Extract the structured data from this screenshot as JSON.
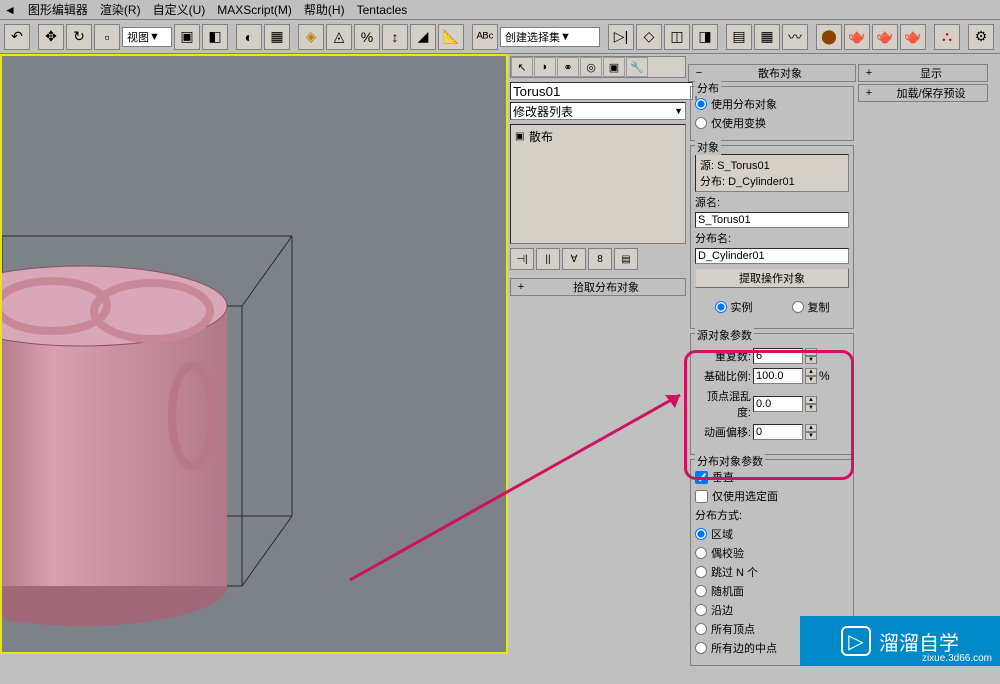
{
  "menu": {
    "items": [
      "图形编辑器",
      "渲染(R)",
      "自定义(U)",
      "MAXScript(M)",
      "帮助(H)",
      "Tentacles"
    ]
  },
  "toolbar": {
    "view_dropdown": "视图",
    "selection_combo": "创建选择集"
  },
  "modifier_panel": {
    "object_name": "Torus01",
    "modifier_dropdown": "修改器列表",
    "modifier_stack": [
      {
        "label": "散布"
      }
    ]
  },
  "rollups": {
    "pick_distribute": "拾取分布对象",
    "scatter_object": "散布对象",
    "display": "显示",
    "load_save": "加载/保存预设"
  },
  "distribution": {
    "group_label": "分布",
    "use_dist_object": "使用分布对象",
    "use_transform_only": "仅使用变换"
  },
  "object_group": {
    "label": "对象",
    "source_label": "源: ",
    "source_value": "S_Torus01",
    "dist_label": "分布: ",
    "dist_value": "D_Cylinder01",
    "source_name_label": "源名:",
    "source_name": "S_Torus01",
    "dist_name_label": "分布名:",
    "dist_name": "D_Cylinder01",
    "extract_button": "提取操作对象",
    "instance": "实例",
    "copy": "复制"
  },
  "source_params": {
    "label": "源对象参数",
    "repeat_label": "重复数:",
    "repeat_value": "6",
    "base_scale_label": "基础比例:",
    "base_scale_value": "100.0",
    "base_scale_unit": "%",
    "vertex_chaos_label": "顶点混乱度:",
    "vertex_chaos_value": "0.0",
    "anim_offset_label": "动画偏移:",
    "anim_offset_value": "0"
  },
  "dist_params": {
    "label": "分布对象参数",
    "perpendicular": "垂直",
    "use_selected_faces": "仅使用选定面",
    "dist_method_label": "分布方式:",
    "area": "区域",
    "even_check": "偶校验",
    "skip_n": "跳过 N 个",
    "random_face": "随机面",
    "along_edge": "沿边",
    "all_vertex": "所有顶点",
    "all_edge_center": "所有边的中点"
  },
  "watermark": {
    "text": "溜溜自学",
    "url": "zixue.3d66.com"
  }
}
